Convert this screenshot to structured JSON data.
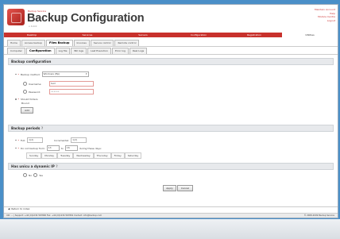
{
  "header": {
    "brand_small": "Backup Service",
    "title": "Backup Configuration",
    "subtitle": "v 4.0.0",
    "top_links": [
      "Maintain Account",
      "Help",
      "Module Centre",
      "Logout"
    ]
  },
  "main_nav": [
    "Desktop",
    "Services",
    "Servers",
    "Configuration",
    "Registration",
    "Utilities"
  ],
  "main_nav_active_index": 5,
  "tabs_row1": [
    "Home",
    "Access backup",
    "Files Backup",
    "Invoices",
    "Secure control",
    "Remote control"
  ],
  "tabs_row1_active_index": 2,
  "tabs_row2": [
    "Computer",
    "Configuration",
    "Log file",
    "Bill logs",
    "Last Execution",
    "Error log",
    "Real Logs"
  ],
  "tabs_row2_active_index": 1,
  "backup_config": {
    "heading": "Backup configuration",
    "method_label": "Backup method:",
    "method_value": "Windows (ftp)",
    "username_label": "Username:",
    "username_value": "test",
    "password_label": "Password:",
    "password_value": "••••••",
    "should_label": "Should folders",
    "should_label2": "Bound",
    "add_button": "Add"
  },
  "backup_periods": {
    "heading": "Backup periods",
    "full_label": "Full:",
    "full_value": "1(d)",
    "incremental_label": "Incremental:",
    "incremental_value": "1(d)",
    "do_not_label": "Do not backup from:",
    "from_value": "13",
    "to_label": "to",
    "to_value": "16",
    "during_label": "during these days:",
    "days": [
      "Sunday",
      "Monday",
      "Tuesday",
      "Wednesday",
      "Thursday",
      "Friday",
      "Saturday"
    ]
  },
  "dynamic_ip": {
    "heading": "Has unicu a dynamic IP",
    "no_label": "No",
    "yes_label": "Yes"
  },
  "buttons": {
    "apply": "Apply",
    "cancel": "Cancel"
  },
  "back_link": "Return to index",
  "status": {
    "left": "Intl: ...  | Support: +44 (0)1234 567890  Fax: +44 (0)1234 567891  Contact: info@backup.com",
    "right": "© 2008-2009 Backup Service"
  },
  "colors": {
    "accent": "#c8312c",
    "background": "#4a8fc8"
  }
}
